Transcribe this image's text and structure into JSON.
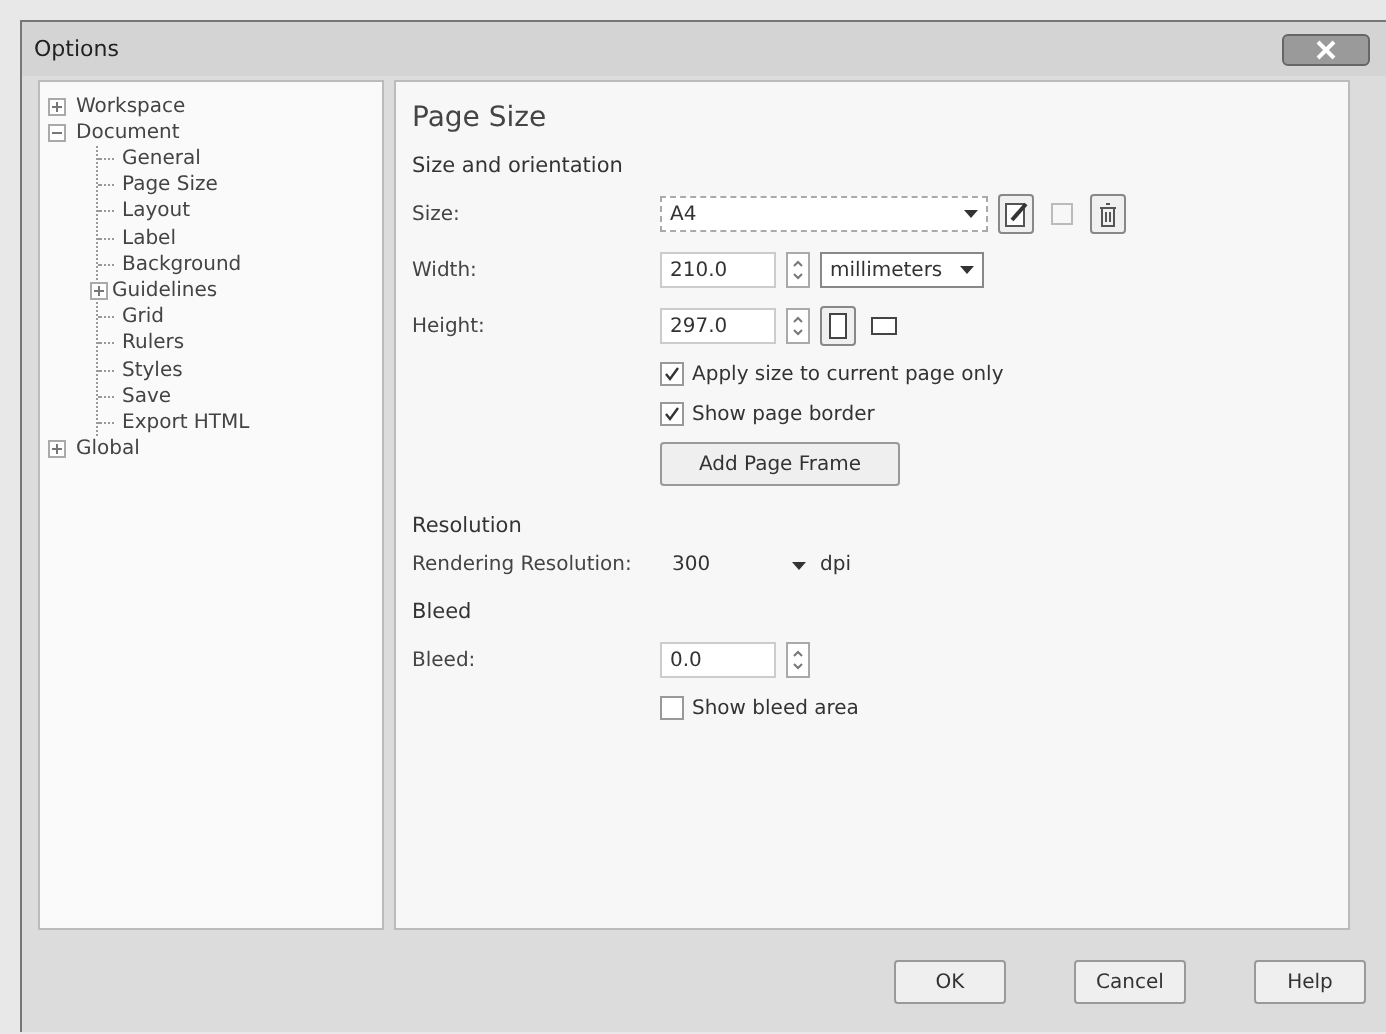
{
  "window": {
    "title": "Options"
  },
  "tree": [
    {
      "label": "Workspace",
      "expanded": false,
      "selected": false
    },
    {
      "label": "Document",
      "expanded": true,
      "selected": false,
      "children": [
        {
          "label": "General",
          "selected": false
        },
        {
          "label": "Page Size",
          "selected": false
        },
        {
          "label": "Layout",
          "selected": false
        },
        {
          "label": "Label",
          "selected": false
        },
        {
          "label": "Background",
          "selected": false
        },
        {
          "label": "Guidelines",
          "selected": false,
          "expanded": false
        },
        {
          "label": "Grid",
          "selected": false
        },
        {
          "label": "Rulers",
          "selected": false
        },
        {
          "label": "Styles",
          "selected": false
        },
        {
          "label": "Save",
          "selected": false
        },
        {
          "label": "Export HTML",
          "selected": false
        }
      ]
    },
    {
      "label": "Global",
      "expanded": false,
      "selected": false
    }
  ],
  "page": {
    "title": "Page Size",
    "size_section": {
      "heading": "Size and orientation",
      "size_label": "Size:",
      "size_value": "A4",
      "width_label": "Width:",
      "width_value": "210.0",
      "unit": "millimeters",
      "height_label": "Height:",
      "height_value": "297.0",
      "orientation_buttons": [
        {
          "kind": "portrait",
          "selected": true
        },
        {
          "kind": "landscape",
          "selected": false
        }
      ],
      "checks": [
        {
          "label": "Apply size to current page only",
          "checked": true
        },
        {
          "label": "Show page border",
          "checked": true
        }
      ],
      "frame_button": "Add Page Frame"
    },
    "resolution_section": {
      "heading": "Resolution",
      "label": "Rendering Resolution:",
      "value": "300",
      "unit": "dpi"
    },
    "bleed_section": {
      "heading": "Bleed",
      "label": "Bleed:",
      "value": "0.0",
      "checks": [
        {
          "label": "Show bleed area",
          "checked": false
        }
      ]
    }
  },
  "buttons": [
    "OK",
    "Cancel",
    "Help"
  ]
}
